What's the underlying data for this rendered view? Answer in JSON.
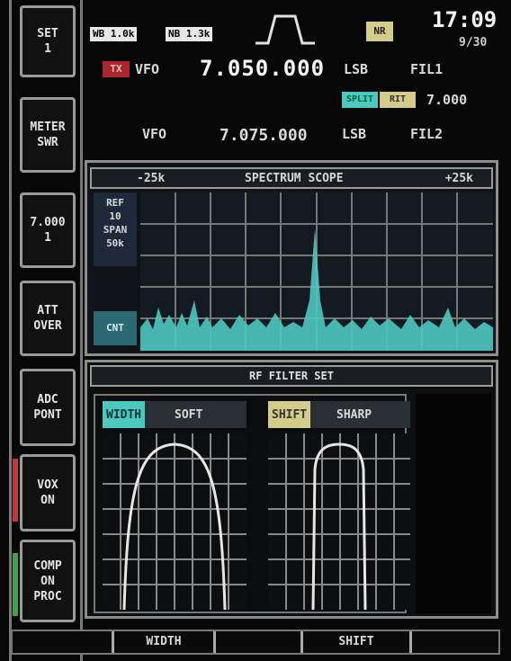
{
  "menu": {
    "items": [
      {
        "line1": "SET",
        "line2": "1"
      },
      {
        "line1": "METER",
        "line2": "SWR"
      },
      {
        "line1": "7.000",
        "line2": "1"
      },
      {
        "line1": "ATT",
        "line2": "OVER"
      },
      {
        "line1": "ADC",
        "line2": "PONT"
      },
      {
        "line1": "VOX",
        "line2": "ON"
      },
      {
        "line1": "COMP",
        "line2": "ON",
        "line3": "PROC"
      }
    ],
    "accent_red": "#c0383a",
    "accent_green": "#3fa34d"
  },
  "status": {
    "box1": "WB 1.0k",
    "box2": "NB 1.3k",
    "mode_badge": "NR",
    "time": "17:09",
    "date": "9/30"
  },
  "vfo_a": {
    "tag": "TX",
    "label": "VFO",
    "freq": "7.050.000",
    "mode": "LSB",
    "filter": "FIL1"
  },
  "split": {
    "tag1": "SPLIT",
    "tag2": "RIT",
    "value": "7.000"
  },
  "vfo_b": {
    "label": "VFO",
    "freq": "7.075.000",
    "mode": "LSB",
    "filter": "FIL2"
  },
  "spectrum": {
    "left_label": "-25k",
    "center_label": "SPECTRUM SCOPE",
    "right_label": "+25k",
    "side_line1": "REF",
    "side_line2": "10",
    "side_line3": "SPAN",
    "side_line4": "50k",
    "bottom_label": "CNT"
  },
  "filter_panel": {
    "title": "RF FILTER SET",
    "left_tag": "WIDTH",
    "left_value": "SOFT",
    "right_tag": "SHIFT",
    "right_value": "SHARP"
  },
  "footer": {
    "left": "WIDTH",
    "right": "SHIFT"
  },
  "colors": {
    "cyan": "#4cc8c0",
    "yellow": "#d4cc8a",
    "red_badge": "#a8262c"
  }
}
